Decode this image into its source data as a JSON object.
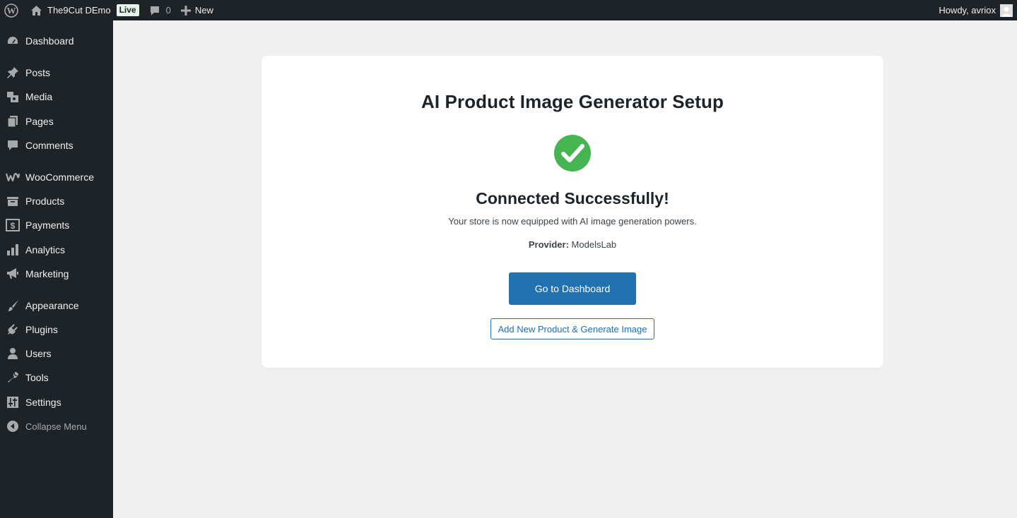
{
  "adminbar": {
    "site_name": "The9Cut DEmo",
    "live_badge": "Live",
    "comments_count": "0",
    "new_label": "New",
    "howdy": "Howdy, avriox"
  },
  "sidebar": {
    "items": [
      {
        "label": "Dashboard",
        "icon": "dashboard-icon"
      },
      {
        "label": "Posts",
        "icon": "pin-icon"
      },
      {
        "label": "Media",
        "icon": "media-icon"
      },
      {
        "label": "Pages",
        "icon": "pages-icon"
      },
      {
        "label": "Comments",
        "icon": "comment-icon"
      },
      {
        "label": "WooCommerce",
        "icon": "woocommerce-icon"
      },
      {
        "label": "Products",
        "icon": "archive-icon"
      },
      {
        "label": "Payments",
        "icon": "dollar-icon"
      },
      {
        "label": "Analytics",
        "icon": "bar-chart-icon"
      },
      {
        "label": "Marketing",
        "icon": "megaphone-icon"
      },
      {
        "label": "Appearance",
        "icon": "paintbrush-icon"
      },
      {
        "label": "Plugins",
        "icon": "plug-icon"
      },
      {
        "label": "Users",
        "icon": "user-icon"
      },
      {
        "label": "Tools",
        "icon": "wrench-icon"
      },
      {
        "label": "Settings",
        "icon": "sliders-icon"
      },
      {
        "label": "Collapse Menu",
        "icon": "collapse-icon"
      }
    ]
  },
  "main": {
    "title": "AI Product Image Generator Setup",
    "success_heading": "Connected Successfully!",
    "description": "Your store is now equipped with AI image generation powers.",
    "provider_label": "Provider:",
    "provider_value": "ModelsLab",
    "primary_button": "Go to Dashboard",
    "secondary_button": "Add New Product & Generate Image"
  },
  "colors": {
    "adminbar_bg": "#1d2327",
    "page_bg": "#f0f0f1",
    "success_green": "#46b450",
    "primary_blue": "#2271b1"
  }
}
